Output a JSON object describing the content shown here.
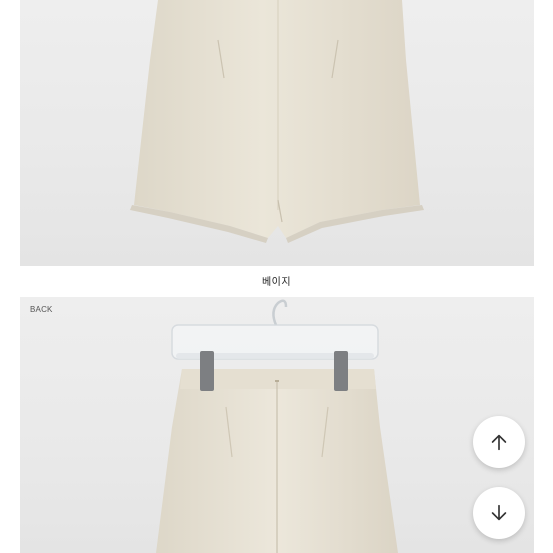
{
  "product": {
    "color_caption": "베이지",
    "back_label": "BACK"
  },
  "controls": {
    "scroll_up_icon": "arrow-up-icon",
    "scroll_down_icon": "arrow-down-icon"
  },
  "colors": {
    "background": "#ececec",
    "garment": "#e6e0d2",
    "hanger": "#dfe3e6"
  }
}
